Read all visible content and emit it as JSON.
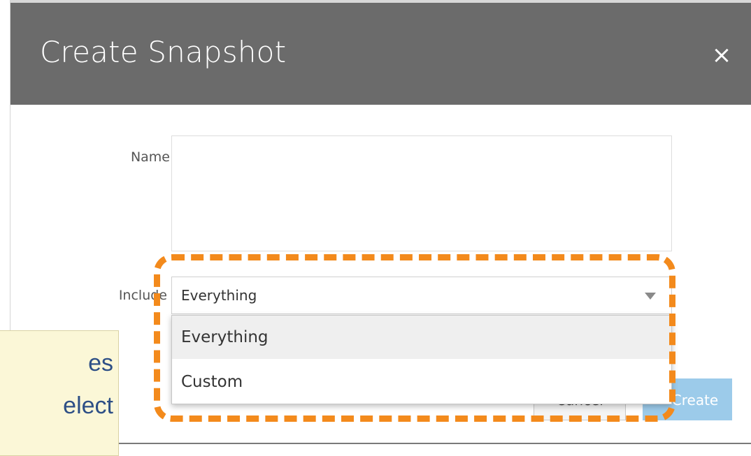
{
  "dialog": {
    "title": "Create Snapshot",
    "close_symbol": "×",
    "name_label": "Name",
    "name_value": "",
    "include_label": "Include",
    "include_selected": "Everything",
    "include_options": [
      "Everything",
      "Custom"
    ],
    "cancel_label": "Cancel",
    "create_label": "Create"
  },
  "callout": {
    "line1": "es",
    "line2": "elect",
    "highlight_color": "#f38a1c"
  },
  "colors": {
    "titlebar": "#6b6b6b",
    "primary_button": "#9ccbea"
  }
}
